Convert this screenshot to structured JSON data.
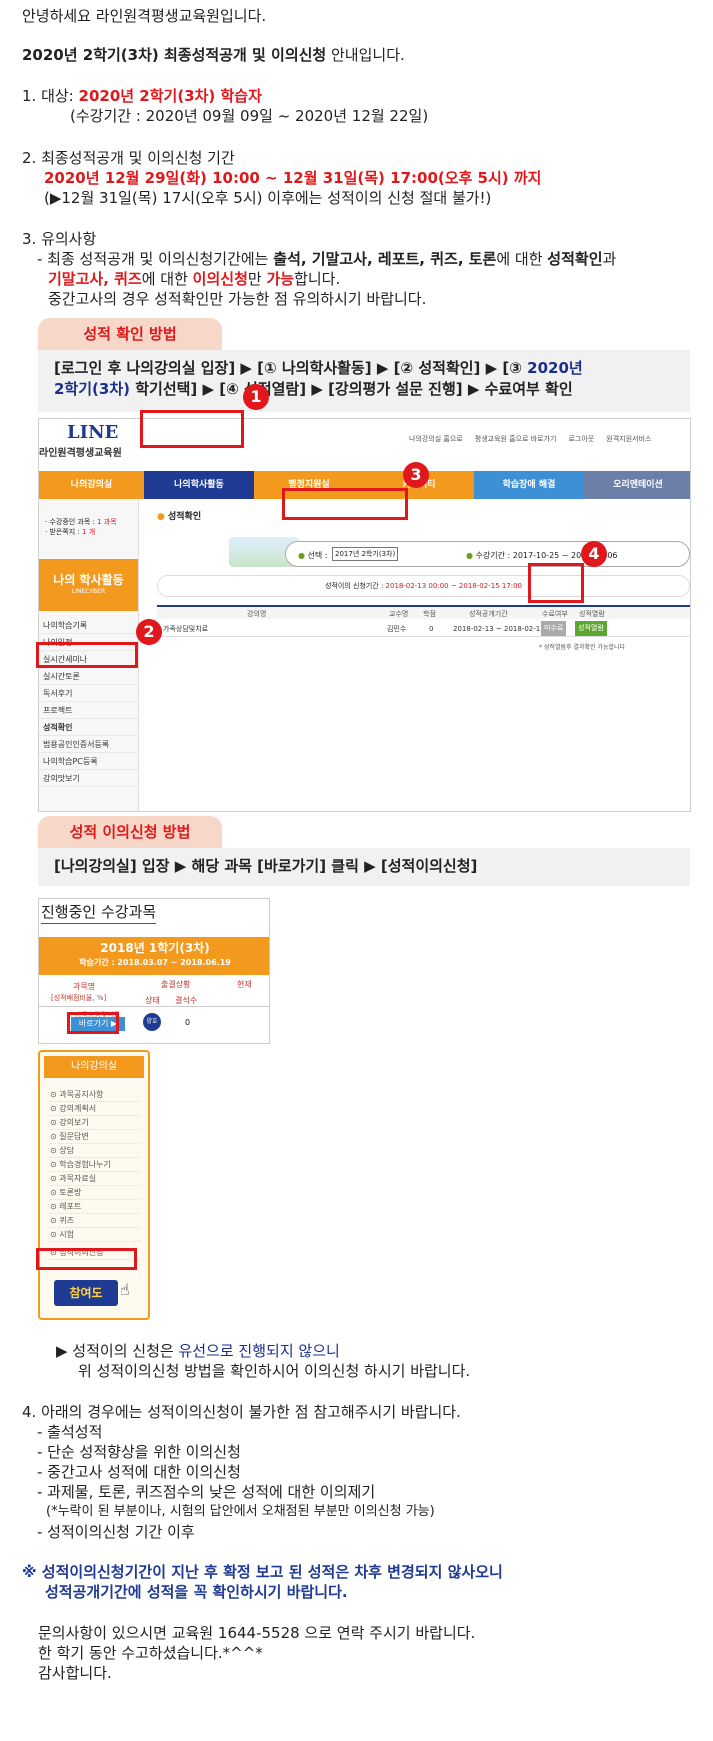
{
  "greeting": "안녕하세요 라인원격평생교육원입니다.",
  "notice": {
    "lead_bold": "2020년 2학기(3차) 최종성적공개 및 이의신청",
    "lead_rest": " 안내입니다."
  },
  "item1": {
    "label": "1. 대상: ",
    "target": "2020년 2학기(3차) 학습자",
    "period": "(수강기간 : 2020년 09월 09일 ~ 2020년 12월 22일)"
  },
  "item2": {
    "label": "2. 최종성적공개 및 이의신청 기간",
    "period": "2020년 12월 29일(화) 10:00 ~ 12월 31일(목) 17:00(오후 5시) 까지",
    "warn": "(▶12월 31일(목) 17시(오후 5시) 이후에는 성적이의 신청 절대 불가!)"
  },
  "item3": {
    "label": "3. 유의사항",
    "l1_a": "- 최종 성적공개 및 이의신청기간에는 ",
    "l1_b": "출석, 기말고사, 레포트, 퀴즈, 토론",
    "l1_c": "에 대한 ",
    "l1_d": "성적확인",
    "l1_e": "과",
    "l2_a": "기말고사, 퀴즈",
    "l2_b": "에 대한 ",
    "l2_c": "이의신청",
    "l2_d": "만 ",
    "l2_e": "가능",
    "l2_f": "합니다.",
    "l3": "중간고사의 경우 성적확인만 가능한 점 유의하시기 바랍니다."
  },
  "check_section": {
    "tab": "성적 확인 방법",
    "line1_a": "[로그인 후 나의강의실 입장] ▶ [① 나의학사활동] ▶ [② 성적확인] ▶ [③ ",
    "line1_b": "2020년",
    "line2_a": "2학기(3차)",
    "line2_b": " 학기선택] ▶ [④ 성적열람] ▶ [강의평가 설문 진행] ▶ 수료여부 확인"
  },
  "shot1": {
    "logo": "LINE",
    "org": "라인원격평생교육원",
    "top_links": [
      "나의강의실 홈으로",
      "평생교육원 홈으로 바로가기",
      "로그아웃",
      "원격지원서비스"
    ],
    "nav": [
      "나의강의실",
      "나의학사활동",
      "행정지원실",
      "커뮤니티",
      "학습장애 해결",
      "오리엔테이션"
    ],
    "side_info1_a": "· 수강중인 과목 : ",
    "side_info1_b": "1 과목",
    "side_info2_a": "· 받은쪽지 : ",
    "side_info2_b": "1 개",
    "side_banner": "나의 학사활동",
    "side_banner_sub": "LINECYBER",
    "side_menu": [
      "나의학습기록",
      "나의일정",
      "실시간세미나",
      "실시간토론",
      "독서후기",
      "프로젝트",
      "성적확인",
      "범용공인인증서등록",
      "나의학습PC등록",
      "강의맛보기"
    ],
    "content_title": "성적확인",
    "select_label": "선택 :",
    "select_value": "2017년 2학기(3차)",
    "period_label": "수강기간 : 2017-10-25 ~ 2018-02-06",
    "appeal_label": "성적이의 신청기간 : ",
    "appeal_period": "2018-02-13 00:00 ~ 2018-02-15 17:00",
    "table_head": [
      "강의명",
      "교수명",
      "학점",
      "성적공개기간",
      "수료여부",
      "성적열람"
    ],
    "table_row": [
      "가족상담및치료",
      "김민수",
      "0",
      "2018-02-13 ~ 2018-02-15",
      "미수료",
      "성적열람"
    ],
    "table_note": "* 성적열람후 결과확인 가능합니다",
    "markers": [
      "1",
      "2",
      "3",
      "4"
    ]
  },
  "appeal_section": {
    "tab": "성적 이의신청 방법",
    "guide": "[나의강의실] 입장 ▶ 해당 과목 [바로가기] 클릭 ▶ [성적이의신청]"
  },
  "shot2": {
    "title": "진행중인 수강과목",
    "term": "2018년 1학기(3차)",
    "term_period": "학습기간 : 2018.03.07 ~ 2018.06.19",
    "col_course": "과목명",
    "col_course_sub": "[성적배점비율, %]",
    "col_attend": "출결상황",
    "col_status": "상태",
    "col_absent": "결석수",
    "col_current": "현재",
    "course_name": "가족상담및치료",
    "goto_btn": "바로가기 ▶",
    "status_badge": "양호",
    "absent_count": "0"
  },
  "shot3": {
    "title": "나의강의실",
    "items": [
      "과목공지사항",
      "강의계획서",
      "강의보기",
      "질문답변",
      "상담",
      "학습경험나누기",
      "과목자료실",
      "토론방",
      "레포트",
      "퀴즈",
      "시험",
      "성적이의신청"
    ],
    "button": "참여도"
  },
  "appeal_note": {
    "l1_a": "▶ 성적이의 신청은 ",
    "l1_b": "유선으로 진행되지 않으니",
    "l2": "위 성적이의신청 방법을 확인하시어 이의신청 하시기 바랍니다."
  },
  "item4": {
    "label": "4. 아래의 경우에는 성적이의신청이 불가한 점 참고해주시기 바랍니다.",
    "lines": [
      "- 출석성적",
      "- 단순 성적향상을 위한 이의신청",
      "- 중간고사 성적에 대한 이의신청",
      "- 과제물, 토론, 퀴즈점수의 낮은 성적에 대한 이의제기",
      "(*누락이 된 부분이나, 시험의 답안에서 오채점된 부분만 이의신청 가능)",
      "- 성적이의신청 기간 이후"
    ]
  },
  "final_notice": {
    "l1": "※ 성적이의신청기간이 지난 후 확정 보고 된 성적은 차후 변경되지 않사오니",
    "l2": "성적공개기간에 성적을 꼭 확인하시기 바랍니다."
  },
  "closing": {
    "l1": "문의사항이 있으시면 교육원 1644-5528 으로 연락 주시기 바랍니다.",
    "l2": "한 학기 동안 수고하셨습니다.*^^*",
    "l3": "감사합니다."
  },
  "colors": {
    "accent_red": "#e0181b",
    "navy": "#1f3a93",
    "orange": "#f39a1e",
    "tab_bg": "#f7d8c8"
  }
}
